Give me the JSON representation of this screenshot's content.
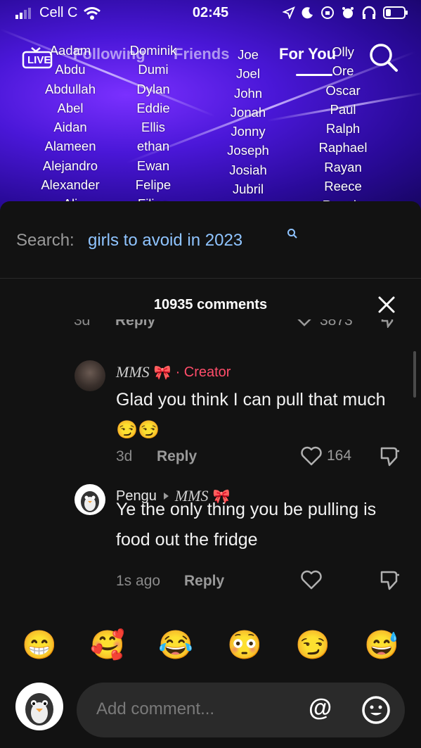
{
  "status_bar": {
    "carrier": "Cell C",
    "time": "02:45"
  },
  "top_nav": {
    "live": "LIVE",
    "following": "Following",
    "friends": "Friends",
    "for_you": "For You"
  },
  "video_names": {
    "col1": [
      "Aadam",
      "Abdu",
      "Abdullah",
      "Abel",
      "Aidan",
      "Alameen",
      "Alejandro",
      "Alexander",
      "Ali"
    ],
    "col2": [
      "Dominik",
      "Dumi",
      "Dylan",
      "Eddie",
      "Ellis",
      "ethan",
      "Ewan",
      "Felipe",
      "Filipe"
    ],
    "col3": [
      "Joe",
      "Joel",
      "John",
      "Jonah",
      "Jonny",
      "Joseph",
      "Josiah",
      "Jubril"
    ],
    "col4": [
      "Olly",
      "Ore",
      "Oscar",
      "Paul",
      "Ralph",
      "Raphael",
      "Rayan",
      "Reece",
      "Reggie"
    ]
  },
  "search": {
    "prefix": "Search:",
    "query": "girls to avoid in 2023"
  },
  "comments_header": {
    "count": "10935 comments"
  },
  "clipped_row": {
    "time": "3d",
    "reply": "Reply",
    "likes": "3873"
  },
  "comments": [
    {
      "author": "MMS",
      "author_emoji": "🎀",
      "creator_label": "· Creator",
      "text": "Glad you think I can pull that much😏😏",
      "time": "3d",
      "reply": "Reply",
      "likes": "164"
    },
    {
      "author": "Pengu",
      "reply_to": "MMS",
      "reply_to_emoji": "🎀",
      "text": "Ye the only thing you be pulling is food out the fridge",
      "time": "1s ago",
      "reply": "Reply",
      "likes": ""
    }
  ],
  "emoji_bar": [
    "😁",
    "🥰",
    "😂",
    "😳",
    "😏",
    "😅"
  ],
  "input": {
    "placeholder": "Add comment...",
    "mention": "@"
  },
  "colors": {
    "accent_creator": "#ff4d6a",
    "search_query": "#8fc4ff",
    "sheet_bg": "#121212"
  }
}
